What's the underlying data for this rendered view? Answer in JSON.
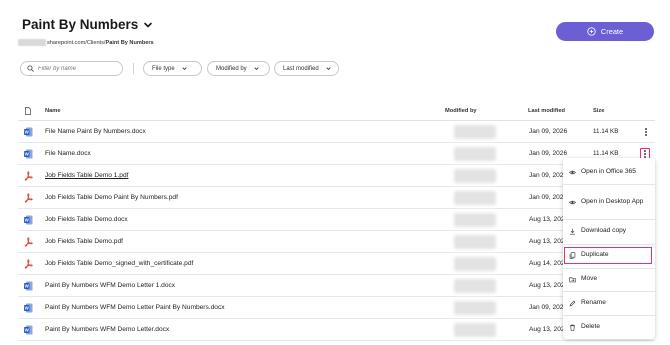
{
  "header": {
    "title": "Paint By Numbers",
    "breadcrumb": {
      "domain": "sharepoint.com",
      "sep": " / ",
      "clients": "Clients",
      "current": "Paint By Numbers"
    },
    "create_label": "Create"
  },
  "filters": {
    "search_placeholder": "Filter by name",
    "file_type": "File type",
    "modified_by": "Modified by",
    "last_modified": "Last modified"
  },
  "table": {
    "headers": {
      "name": "Name",
      "modified_by": "Modified by",
      "last_modified": "Last modified",
      "size": "Size"
    },
    "rows": [
      {
        "name": "File Name Paint By Numbers.docx",
        "type": "word",
        "date": "Jan 09, 2026",
        "size": "11.14 KB"
      },
      {
        "name": "File Name.docx",
        "type": "word",
        "date": "Jan 09, 2026",
        "size": "11.14 KB"
      },
      {
        "name": "Job Fields Table Demo 1.pdf",
        "type": "pdf",
        "date": "Jan 09, 2026",
        "size": ""
      },
      {
        "name": "Job Fields Table Demo Paint By Numbers.pdf",
        "type": "pdf",
        "date": "Jan 09, 2026",
        "size": ""
      },
      {
        "name": "Job Fields Table Demo.docx",
        "type": "word",
        "date": "Aug 13, 2025",
        "size": ""
      },
      {
        "name": "Job Fields Table Demo.pdf",
        "type": "pdf",
        "date": "Aug 13, 2025",
        "size": ""
      },
      {
        "name": "Job Fields Table Demo_signed_with_certificate.pdf",
        "type": "pdf",
        "date": "Aug 14, 2025",
        "size": ""
      },
      {
        "name": "Paint By Numbers WFM Demo Letter 1.docx",
        "type": "word",
        "date": "Aug 13, 2025",
        "size": ""
      },
      {
        "name": "Paint By Numbers WFM Demo Letter Paint By Numbers.docx",
        "type": "word",
        "date": "Jan 09, 2026",
        "size": ""
      },
      {
        "name": "Paint By Numbers WFM Demo Letter.docx",
        "type": "word",
        "date": "Aug 13, 2025",
        "size": ""
      }
    ]
  },
  "context_menu": {
    "open_office": "Open in Office 365",
    "open_desktop": "Open in Desktop App",
    "download": "Download copy",
    "duplicate": "Duplicate",
    "move": "Move",
    "rename": "Rename",
    "delete": "Delete"
  },
  "colors": {
    "accent": "#6b5fd3",
    "highlight": "#e2317a",
    "word": "#2b5fc4",
    "pdf": "#e0442c"
  }
}
